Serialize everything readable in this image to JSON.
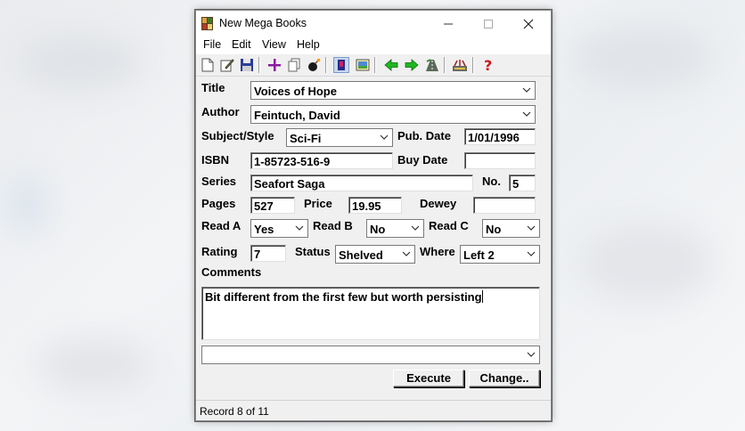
{
  "window": {
    "title": "New Mega Books",
    "controls": {
      "minimize": "—",
      "maximize": "☐",
      "close": "✕"
    }
  },
  "menu": [
    "File",
    "Edit",
    "View",
    "Help"
  ],
  "toolbar_icons": [
    "new-document-icon",
    "edit-icon",
    "save-icon",
    "add-record-icon",
    "copy-icon",
    "delete-bomb-icon",
    "book-view-icon",
    "picture-view-icon",
    "previous-arrow-icon",
    "next-arrow-icon",
    "road-icon",
    "options-icon",
    "help-question-icon"
  ],
  "form": {
    "title": {
      "label": "Title",
      "value": "Voices of Hope"
    },
    "author": {
      "label": "Author",
      "value": "Feintuch, David"
    },
    "subject": {
      "label": "Subject/Style",
      "value": "Sci-Fi"
    },
    "pub_date": {
      "label": "Pub. Date",
      "value": "1/01/1996"
    },
    "isbn": {
      "label": "ISBN",
      "value": "1-85723-516-9"
    },
    "buy_date": {
      "label": "Buy Date",
      "value": ""
    },
    "series": {
      "label": "Series",
      "value": "Seafort Saga"
    },
    "number": {
      "label": "No.",
      "value": "5"
    },
    "pages": {
      "label": "Pages",
      "value": "527"
    },
    "price": {
      "label": "Price",
      "value": "19.95"
    },
    "dewey": {
      "label": "Dewey",
      "value": ""
    },
    "read_a": {
      "label": "Read A",
      "value": "Yes"
    },
    "read_b": {
      "label": "Read B",
      "value": "No"
    },
    "read_c": {
      "label": "Read C",
      "value": "No"
    },
    "rating": {
      "label": "Rating",
      "value": "7"
    },
    "status": {
      "label": "Status",
      "value": "Shelved"
    },
    "where": {
      "label": "Where",
      "value": "Left 2"
    },
    "comments": {
      "label": "Comments",
      "value": "Bit different from the first few but worth persisting"
    },
    "query": {
      "value": ""
    }
  },
  "buttons": {
    "execute": "Execute",
    "change": "Change.."
  },
  "status_bar": "Record 8 of 11"
}
